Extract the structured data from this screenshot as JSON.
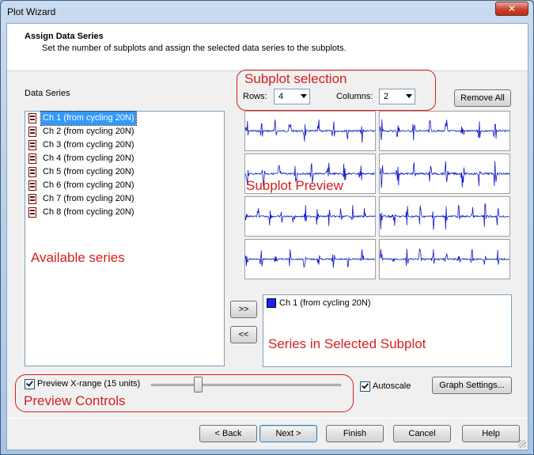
{
  "window": {
    "title": "Plot Wizard",
    "close_glyph": "✕"
  },
  "header": {
    "title": "Assign Data Series",
    "description": "Set the number of subplots and assign the selected data series to the subplots."
  },
  "data_series": {
    "label": "Data Series",
    "items": [
      "Ch 1 (from cycling 20N)",
      "Ch 2 (from cycling 20N)",
      "Ch 3 (from cycling 20N)",
      "Ch 4 (from cycling 20N)",
      "Ch 5 (from cycling 20N)",
      "Ch 6 (from cycling 20N)",
      "Ch 7 (from cycling 20N)",
      "Ch 8 (from cycling 20N)"
    ],
    "selected_index": 0
  },
  "subplot_selection": {
    "rows_label": "Rows:",
    "rows_value": "4",
    "columns_label": "Columns:",
    "columns_value": "2"
  },
  "buttons": {
    "remove_all": "Remove All",
    "add": ">>",
    "remove": "<<",
    "graph_settings": "Graph Settings...",
    "back": "< Back",
    "next": "Next >",
    "finish": "Finish",
    "cancel": "Cancel",
    "help": "Help"
  },
  "selected_subplot_series": {
    "items": [
      "Ch 1 (from cycling 20N)"
    ],
    "swatch_color": "#1a23ff"
  },
  "preview_controls": {
    "preview_xrange_label": "Preview X-range (15 units)",
    "preview_xrange_checked": true,
    "slider_fraction": 0.24,
    "autoscale_label": "Autoscale",
    "autoscale_checked": true
  },
  "annotations": {
    "subplot_selection": "Subplot selection",
    "subplot_preview": "Subplot Preview",
    "available_series": "Available series",
    "series_in_selected_subplot": "Series in Selected Subplot",
    "preview_controls": "Preview Controls"
  },
  "colors": {
    "annotation_red": "#d42020",
    "waveform_blue": "#0a14c8",
    "selection_blue": "#3399ff"
  }
}
